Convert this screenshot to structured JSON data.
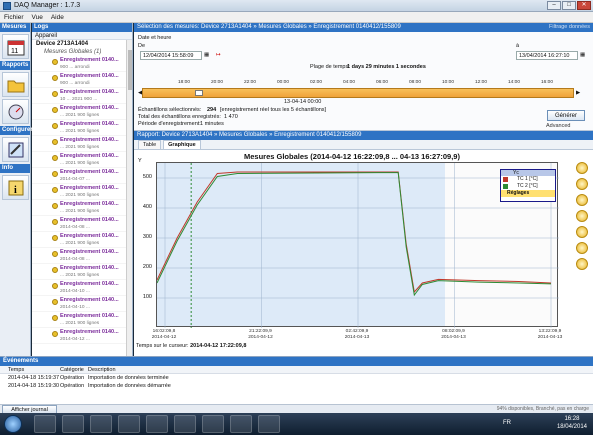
{
  "window": {
    "title": "DAQ Manager : 1.7.3"
  },
  "menu": [
    "Fichier",
    "Vue",
    "Aide"
  ],
  "leftbar": {
    "mesures": "Mesures",
    "rapports": "Rapports",
    "configurer": "Configurer",
    "info": "Info"
  },
  "logs": {
    "header": "Logs",
    "subheader": "Appareil",
    "device": "Device 2713A1404",
    "group": "Mesures Globales (1)",
    "items": [
      {
        "name": "Enregistrement 0140...",
        "desc": "900 ... arrondi"
      },
      {
        "name": "Enregistrement 0140...",
        "desc": "900 ... arrondi"
      },
      {
        "name": "Enregistrement 0140...",
        "desc": "10 ... 2021 900 ..."
      },
      {
        "name": "Enregistrement 0140...",
        "desc": "... 2021 900 lignes"
      },
      {
        "name": "Enregistrement 0140...",
        "desc": "... 2021 900 lignes"
      },
      {
        "name": "Enregistrement 0140...",
        "desc": "... 2021 900 lignes"
      },
      {
        "name": "Enregistrement 0140...",
        "desc": "... 2021 900 lignes"
      },
      {
        "name": "Enregistrement 0140...",
        "desc": "2014-04-07 ..."
      },
      {
        "name": "Enregistrement 0140...",
        "desc": "... 2021 900 lignes"
      },
      {
        "name": "Enregistrement 0140...",
        "desc": "... 2021 900 lignes"
      },
      {
        "name": "Enregistrement 0140...",
        "desc": "2014-04-08 ..."
      },
      {
        "name": "Enregistrement 0140...",
        "desc": "... 2021 900 lignes"
      },
      {
        "name": "Enregistrement 0140...",
        "desc": "2014-04-08 ..."
      },
      {
        "name": "Enregistrement 0140...",
        "desc": "... 2021 900 lignes"
      },
      {
        "name": "Enregistrement 0140...",
        "desc": "2014-04-10 ..."
      },
      {
        "name": "Enregistrement 0140...",
        "desc": "2014-04-10 ..."
      },
      {
        "name": "Enregistrement 0140...",
        "desc": "... 2021 900 lignes"
      },
      {
        "name": "Enregistrement 0140...",
        "desc": "2014-04-12 ..."
      }
    ]
  },
  "selection": {
    "header": "Sélection des mesures: Device 2713A1404 » Mesures Globales » Enregistrement 0140412/155809",
    "filter": "Filtrage données",
    "date_label": "Date et heure",
    "de": "De",
    "from": "12/04/2014 15:58:09",
    "a": "à",
    "to": "13/04/2014 16:27:10",
    "range_label": "Plage de temps:",
    "range_value": "1 days 29 minutes 1 secondes",
    "tl_start": "13-04-14 00:00",
    "ticks": [
      "18:00",
      "20:00",
      "22:00",
      "00:00",
      "02:00",
      "04:00",
      "06:00",
      "08:00",
      "10:00",
      "12:00",
      "14:00",
      "16:00"
    ],
    "selected_label": "Échantillons sélectionnés:",
    "selected_value": "294",
    "selected_suffix": "[enregistrement réel tous les 5 échantillons]",
    "total_label": "Total des échantillons enregistrés:",
    "total_value": "1 470",
    "period_label": "Période d'enregistrement:",
    "period_value": "1 minutes",
    "generate": "Générer",
    "advanced": "Advanced"
  },
  "report": {
    "header": "Rapport: Device 2713A1404 » Mesures Globales » Enregistrement 0140412/155809",
    "tabs": [
      "Table",
      "Graphique"
    ],
    "cursor_label": "Temps sur le curseur:",
    "cursor_value": "2014-04-12 17:22:09,8"
  },
  "chart_data": {
    "type": "line",
    "title": "Mesures Globales (2014-04-12 16:22:09,8 ... 04-13 16:27:09,9)",
    "ylabel": "Y",
    "ylim": [
      0,
      550
    ],
    "yticks": [
      100,
      200,
      300,
      400,
      500
    ],
    "x": [
      "16:02:09,8",
      "21:22:09,9",
      "02:42:09,9",
      "08:02:09,9",
      "13:22:09,9"
    ],
    "x_dates": [
      "2014-04-12",
      "2014-04-12",
      "2014-04-13",
      "2014-04-13",
      "2014-04-13"
    ],
    "legend": {
      "header": "Yc",
      "items": [
        "TC 1 [°C]",
        "TC 2 [°C]"
      ],
      "footer": "Réglages"
    },
    "series": [
      {
        "name": "TC 1 [°C]",
        "color": "#c0392b",
        "points": [
          [
            0,
            160
          ],
          [
            5,
            300
          ],
          [
            10,
            420
          ],
          [
            15,
            515
          ],
          [
            20,
            520
          ],
          [
            55,
            520
          ],
          [
            60,
            520
          ],
          [
            62,
            280
          ],
          [
            64,
            120
          ],
          [
            66,
            150
          ],
          [
            70,
            162
          ],
          [
            80,
            158
          ],
          [
            90,
            155
          ],
          [
            98,
            150
          ]
        ]
      },
      {
        "name": "TC 2 [°C]",
        "color": "#2e8b35",
        "points": [
          [
            0,
            150
          ],
          [
            5,
            290
          ],
          [
            10,
            410
          ],
          [
            15,
            505
          ],
          [
            20,
            515
          ],
          [
            55,
            518
          ],
          [
            60,
            518
          ],
          [
            62,
            270
          ],
          [
            64,
            110
          ],
          [
            66,
            145
          ],
          [
            70,
            158
          ],
          [
            80,
            153
          ],
          [
            90,
            150
          ],
          [
            98,
            147
          ]
        ]
      }
    ]
  },
  "events": {
    "header": "Événements",
    "cols": [
      "Temps",
      "Catégorie",
      "Description"
    ],
    "rows": [
      [
        "2014-04-18 15:19:37",
        "Opération",
        "Importation de données terminée"
      ],
      [
        "2014-04-18 15:19:30",
        "Opération",
        "Importation de données démarrée"
      ]
    ]
  },
  "statusbar": {
    "button": "Afficher journal",
    "status": "94% disponibles, Branché, pas en charge"
  },
  "taskbar": {
    "lang": "FR",
    "time": "16:28",
    "date": "18/04/2014"
  }
}
